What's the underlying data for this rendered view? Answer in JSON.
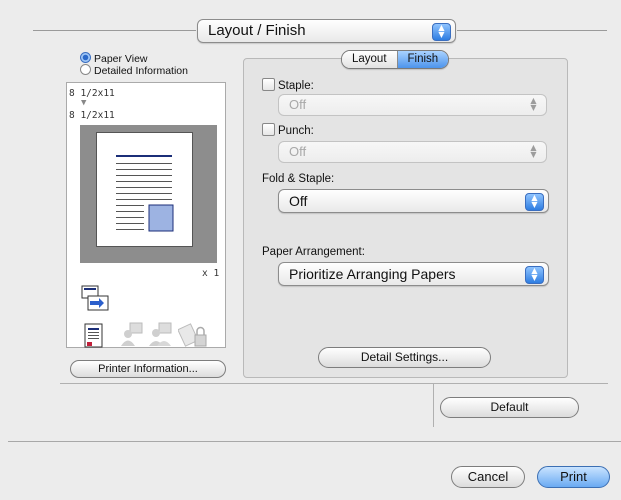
{
  "header": {
    "panel_selector": "Layout / Finish"
  },
  "preview": {
    "view_options": [
      "Paper View",
      "Detailed Information"
    ],
    "selected_view": "Paper View",
    "source_size": "8 1/2x11",
    "output_size": "8 1/2x11",
    "copies_indicator": "x 1",
    "printer_info_button": "Printer Information..."
  },
  "tabs": [
    "Layout",
    "Finish"
  ],
  "active_tab": "Finish",
  "finish": {
    "staple_label": "Staple:",
    "staple_value": "Off",
    "punch_label": "Punch:",
    "punch_value": "Off",
    "fold_staple_label": "Fold & Staple:",
    "fold_staple_value": "Off",
    "paper_arrangement_label": "Paper Arrangement:",
    "paper_arrangement_value": "Prioritize Arranging Papers",
    "detail_settings_button": "Detail Settings..."
  },
  "footer": {
    "default_button": "Default",
    "cancel_button": "Cancel",
    "print_button": "Print"
  },
  "colors": {
    "accent": "#4d94ec",
    "panel": "#e4e4e4"
  }
}
